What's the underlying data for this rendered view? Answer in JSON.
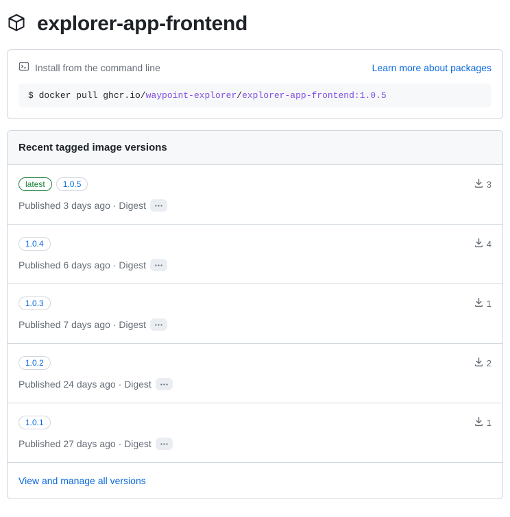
{
  "header": {
    "package_name": "explorer-app-frontend"
  },
  "install": {
    "label": "Install from the command line",
    "learn_more": "Learn more about packages",
    "prompt": "$ ",
    "cmd_prefix": "docker pull ghcr.io/",
    "org": "waypoint-explorer",
    "slash": "/",
    "pkg_tag": "explorer-app-frontend:1.0.5"
  },
  "versions": {
    "heading": "Recent tagged image versions",
    "items": [
      {
        "tags": [
          {
            "label": "latest",
            "style": "green"
          },
          {
            "label": "1.0.5",
            "style": "blue"
          }
        ],
        "published_prefix": "Published ",
        "published_time": "3 days ago",
        "digest_sep": " · ",
        "digest_label": "Digest",
        "downloads": "3"
      },
      {
        "tags": [
          {
            "label": "1.0.4",
            "style": "blue"
          }
        ],
        "published_prefix": "Published ",
        "published_time": "6 days ago",
        "digest_sep": " · ",
        "digest_label": "Digest",
        "downloads": "4"
      },
      {
        "tags": [
          {
            "label": "1.0.3",
            "style": "blue"
          }
        ],
        "published_prefix": "Published ",
        "published_time": "7 days ago",
        "digest_sep": " · ",
        "digest_label": "Digest",
        "downloads": "1"
      },
      {
        "tags": [
          {
            "label": "1.0.2",
            "style": "blue"
          }
        ],
        "published_prefix": "Published ",
        "published_time": "24 days ago",
        "digest_sep": " · ",
        "digest_label": "Digest",
        "downloads": "2"
      },
      {
        "tags": [
          {
            "label": "1.0.1",
            "style": "blue"
          }
        ],
        "published_prefix": "Published ",
        "published_time": "27 days ago",
        "digest_sep": " · ",
        "digest_label": "Digest",
        "downloads": "1"
      }
    ],
    "view_all": "View and manage all versions"
  }
}
